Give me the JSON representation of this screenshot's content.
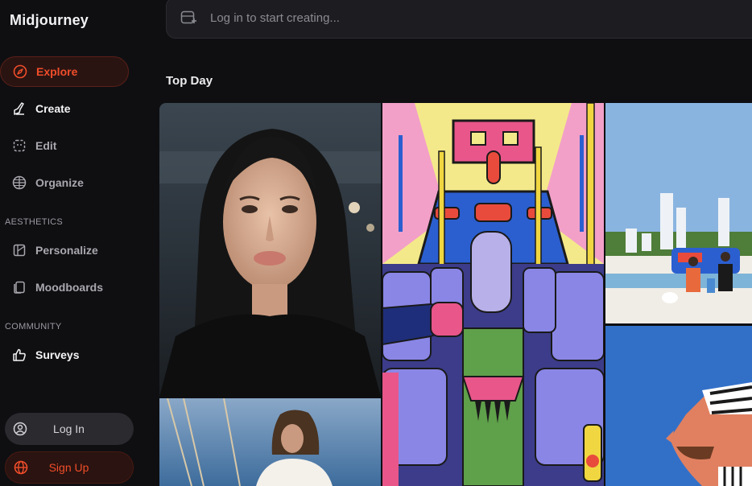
{
  "app": {
    "title": "Midjourney"
  },
  "sidebar": {
    "items": [
      {
        "label": "Explore",
        "icon": "compass-icon"
      },
      {
        "label": "Create",
        "icon": "paintbrush-icon"
      },
      {
        "label": "Edit",
        "icon": "edit-frame-icon"
      },
      {
        "label": "Organize",
        "icon": "grid-globe-icon"
      }
    ],
    "aesthetics_heading": "AESTHETICS",
    "aesthetics_items": [
      {
        "label": "Personalize",
        "icon": "personalize-icon"
      },
      {
        "label": "Moodboards",
        "icon": "moodboards-icon"
      }
    ],
    "community_heading": "COMMUNITY",
    "community_items": [
      {
        "label": "Surveys",
        "icon": "thumbs-up-icon"
      }
    ],
    "login_label": "Log In",
    "signup_label": "Sign Up"
  },
  "search": {
    "placeholder": "Log in to start creating..."
  },
  "main": {
    "section_title": "Top Day"
  },
  "colors": {
    "accent": "#f04d2a",
    "background": "#0f0f12"
  }
}
